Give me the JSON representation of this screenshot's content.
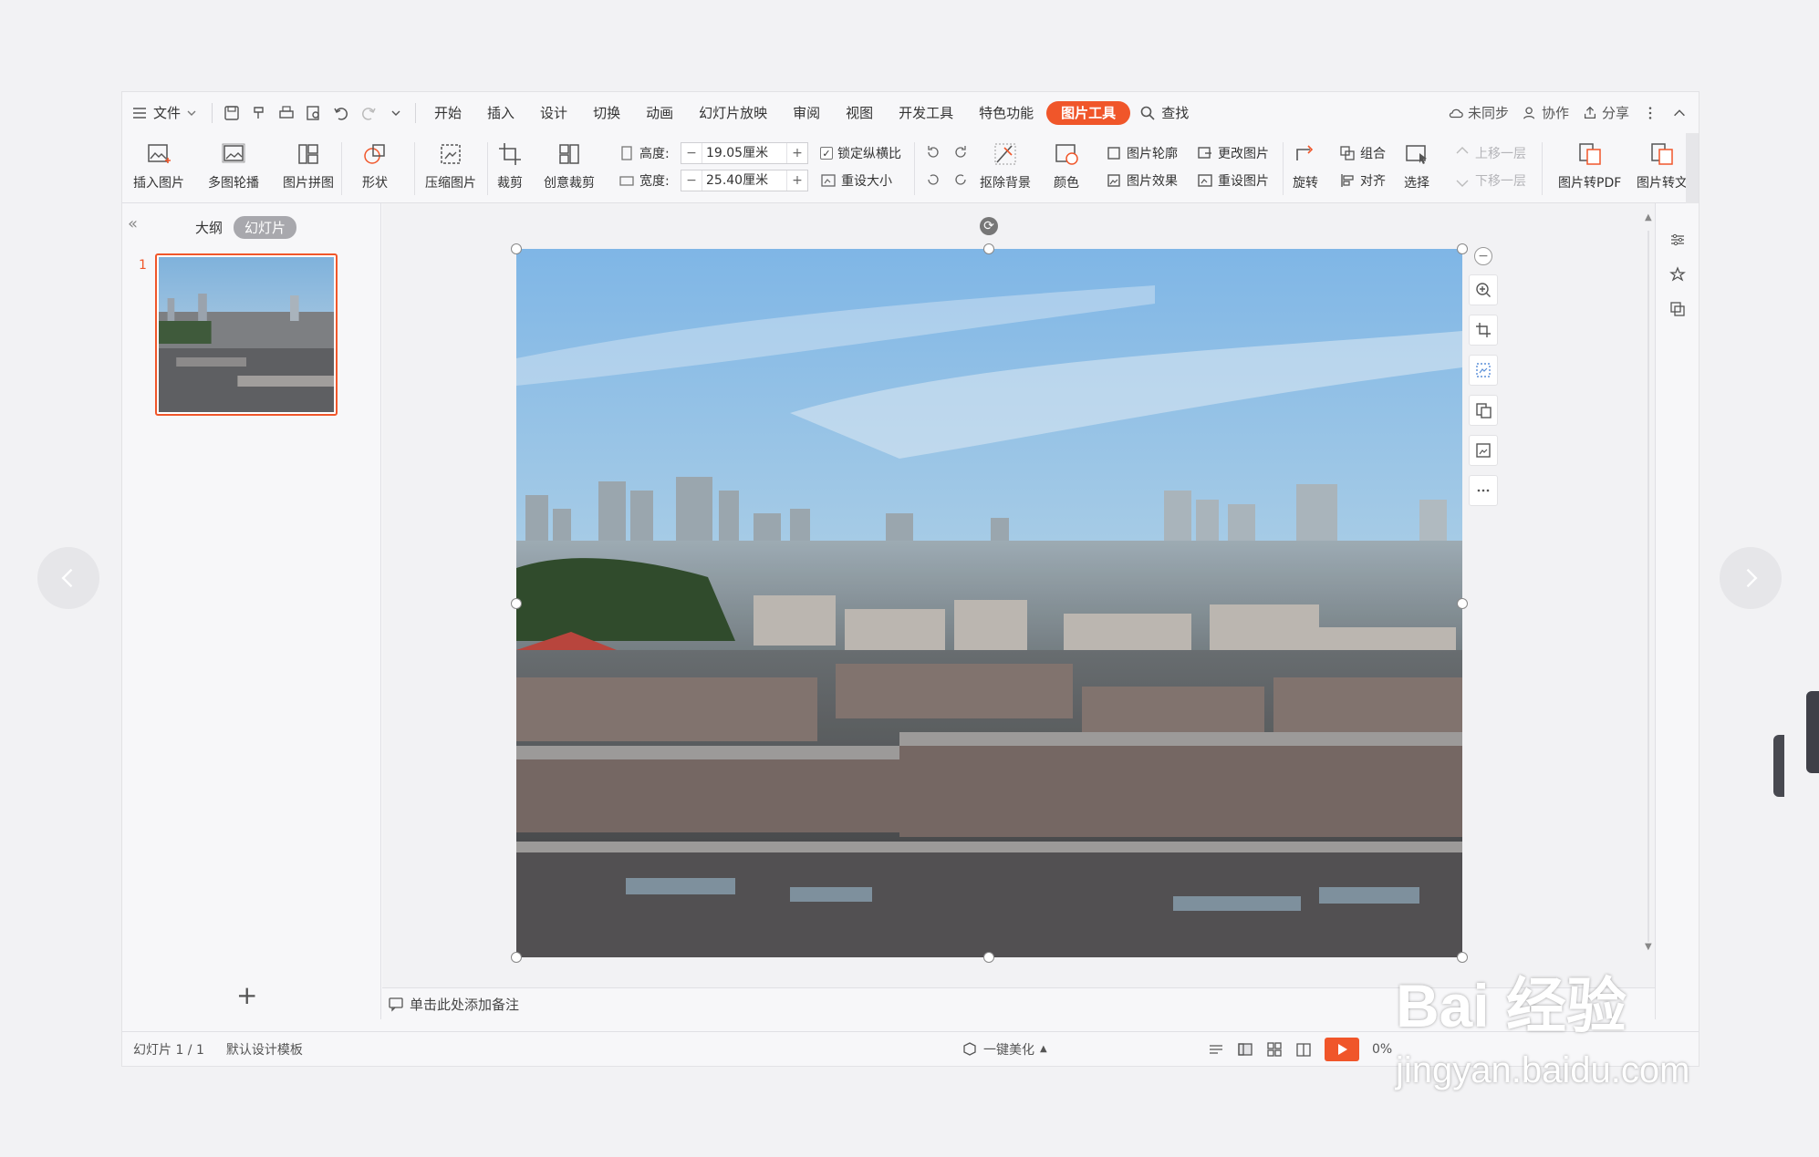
{
  "app": {
    "menu": {
      "file_label": "文件"
    },
    "tabs": [
      "开始",
      "插入",
      "设计",
      "切换",
      "动画",
      "幻灯片放映",
      "审阅",
      "视图",
      "开发工具",
      "特色功能"
    ],
    "active_tab": "图片工具",
    "search_label": "查找",
    "right_actions": {
      "sync": "未同步",
      "collab": "协作",
      "share": "分享"
    }
  },
  "ribbon": {
    "insert_picture": "插入图片",
    "multi_carousel": "多图轮播",
    "picture_collage": "图片拼图",
    "shape": "形状",
    "compress": "压缩图片",
    "crop": "裁剪",
    "creative_crop": "创意裁剪",
    "height_label": "高度:",
    "height_value": "19.05厘米",
    "width_label": "宽度:",
    "width_value": "25.40厘米",
    "lock_ratio": "锁定纵横比",
    "reset_size": "重设大小",
    "remove_bg": "抠除背景",
    "color": "颜色",
    "pic_outline": "图片轮廓",
    "pic_effect": "图片效果",
    "change_pic": "更改图片",
    "reset_pic": "重设图片",
    "rotate": "旋转",
    "group": "组合",
    "align": "对齐",
    "select": "选择",
    "bring_forward": "上移一层",
    "send_backward": "下移一层",
    "to_pdf": "图片转PDF",
    "to_word": "图片转文"
  },
  "left_pane": {
    "outline_tab": "大纲",
    "slides_tab": "幻灯片",
    "slide_number": "1",
    "add_slide": "+"
  },
  "notes": {
    "placeholder": "单击此处添加备注"
  },
  "status": {
    "slide_info": "幻灯片 1 / 1",
    "template": "默认设计模板",
    "beautify": "一键美化",
    "zoom": "0%"
  },
  "watermark": {
    "brand": "Bai 经验",
    "url": "jingyan.baidu.com"
  },
  "colors": {
    "accent": "#f0562a",
    "bg": "#f2f2f4"
  }
}
